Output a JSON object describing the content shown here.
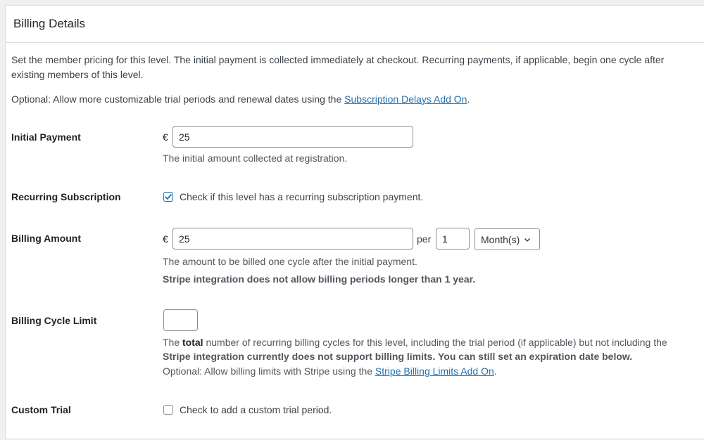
{
  "panel": {
    "title": "Billing Details"
  },
  "intro": {
    "line1": "Set the member pricing for this level. The initial payment is collected immediately at checkout. Recurring payments, if applicable, begin one cycle after",
    "line2": "existing members of this level.",
    "optional_prefix": "Optional: Allow more customizable trial periods and renewal dates using the ",
    "optional_link": "Subscription Delays Add On",
    "optional_suffix": "."
  },
  "initial_payment": {
    "label": "Initial Payment",
    "currency": "€",
    "value": "25",
    "description": "The initial amount collected at registration."
  },
  "recurring_subscription": {
    "label": "Recurring Subscription",
    "checked": true,
    "checkbox_label": "Check if this level has a recurring subscription payment."
  },
  "billing_amount": {
    "label": "Billing Amount",
    "currency": "€",
    "value": "25",
    "per_label": "per",
    "cycle_number": "1",
    "cycle_period": "Month(s)",
    "description": "The amount to be billed one cycle after the initial payment.",
    "warning": "Stripe integration does not allow billing periods longer than 1 year."
  },
  "billing_cycle_limit": {
    "label": "Billing Cycle Limit",
    "value": "",
    "desc_prefix": "The ",
    "desc_bold": "total",
    "desc_suffix": " number of recurring billing cycles for this level, including the trial period (if applicable) but not including the",
    "warning": "Stripe integration currently does not support billing limits. You can still set an expiration date below.",
    "optional_prefix": "Optional: Allow billing limits with Stripe using the ",
    "optional_link": "Stripe Billing Limits Add On",
    "optional_suffix": "."
  },
  "custom_trial": {
    "label": "Custom Trial",
    "checked": false,
    "checkbox_label": "Check to add a custom trial period."
  },
  "colors": {
    "link": "#2271b1",
    "checkbox_accent": "#2271b1"
  }
}
